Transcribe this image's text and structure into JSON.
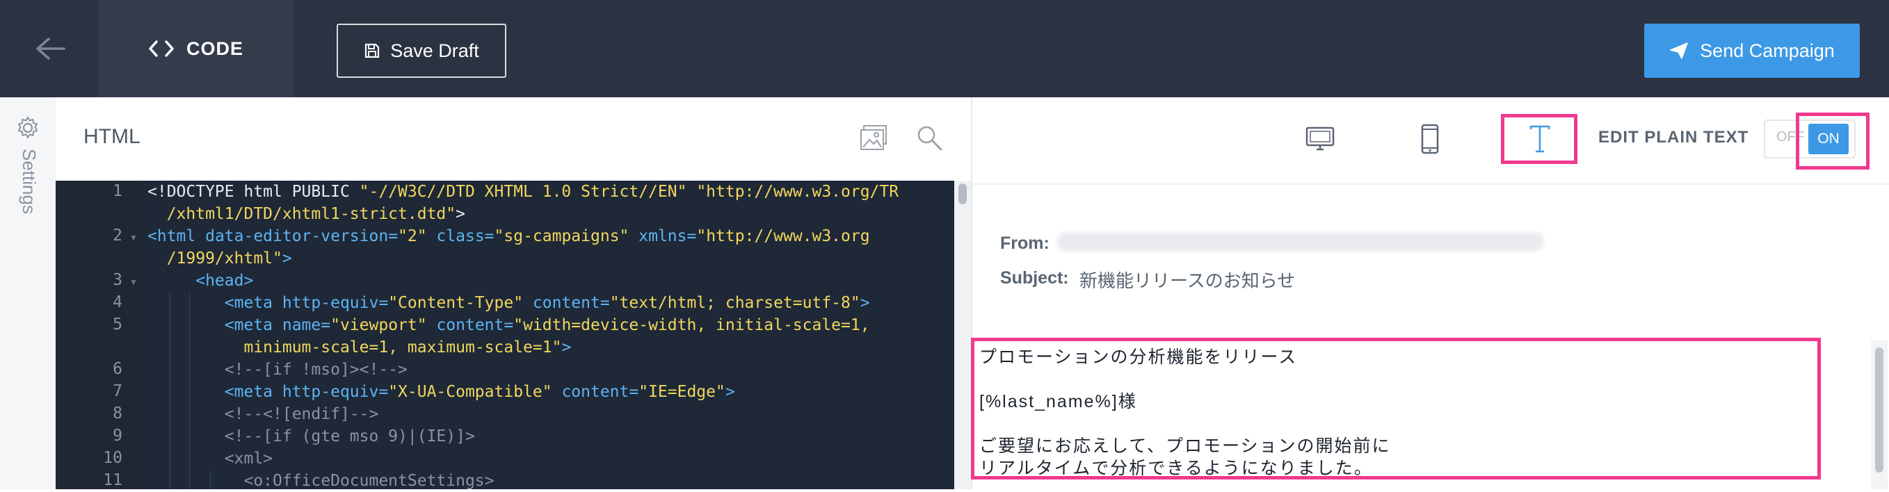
{
  "topbar": {
    "back_icon": "arrow-left-icon",
    "tab_label": "CODE",
    "tab_icon": "code-brackets-icon",
    "save_draft_label": "Save Draft",
    "save_icon": "floppy-disk-icon",
    "send_label": "Send Campaign",
    "send_icon": "paper-plane-icon"
  },
  "sidebar": {
    "settings_label": "Settings",
    "settings_icon": "gear-icon"
  },
  "editor": {
    "title": "HTML",
    "image_icon": "image-icon",
    "search_icon": "search-icon",
    "line_numbers": [
      "1",
      "2",
      "3",
      "4",
      "5",
      "6",
      "7",
      "8",
      "9",
      "10",
      "11"
    ]
  },
  "preview": {
    "desktop_icon": "desktop-icon",
    "mobile_icon": "mobile-icon",
    "text_icon": "text-t-icon",
    "edit_plain_text_label": "EDIT PLAIN TEXT",
    "toggle_off": "OFF",
    "toggle_on": "ON",
    "from_label": "From:",
    "subject_label": "Subject:",
    "subject_value": "新機能リリースのお知らせ",
    "body_lines": [
      "プロモーションの分析機能をリリース",
      "",
      "[%last_name%]様",
      "",
      "ご要望にお応えして、プロモーションの開始前に",
      "リアルタイムで分析できるようになりました。"
    ]
  },
  "colors": {
    "topbar": "#2b3241",
    "accent": "#3d99e6",
    "highlight": "#f0398f",
    "code_bg": "#1e2837"
  }
}
